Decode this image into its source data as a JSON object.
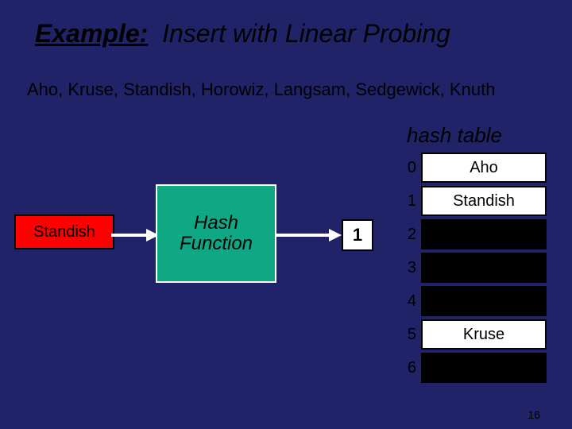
{
  "title_example": "Example:",
  "title_rest": "Insert with Linear Probing",
  "subtitle": "Aho, Kruse, Standish, Horowiz, Langsam, Sedgewick, Knuth",
  "caption": "hash table",
  "input_name": "Standish",
  "hash_label": "Hash\nFunction",
  "hash_output": "1",
  "table": [
    {
      "index": "0",
      "value": "Aho",
      "filled": true
    },
    {
      "index": "1",
      "value": "Standish",
      "filled": true
    },
    {
      "index": "2",
      "value": "",
      "filled": false
    },
    {
      "index": "3",
      "value": "",
      "filled": false
    },
    {
      "index": "4",
      "value": "",
      "filled": false
    },
    {
      "index": "5",
      "value": "Kruse",
      "filled": true
    },
    {
      "index": "6",
      "value": "",
      "filled": false
    }
  ],
  "slide_number": "16"
}
